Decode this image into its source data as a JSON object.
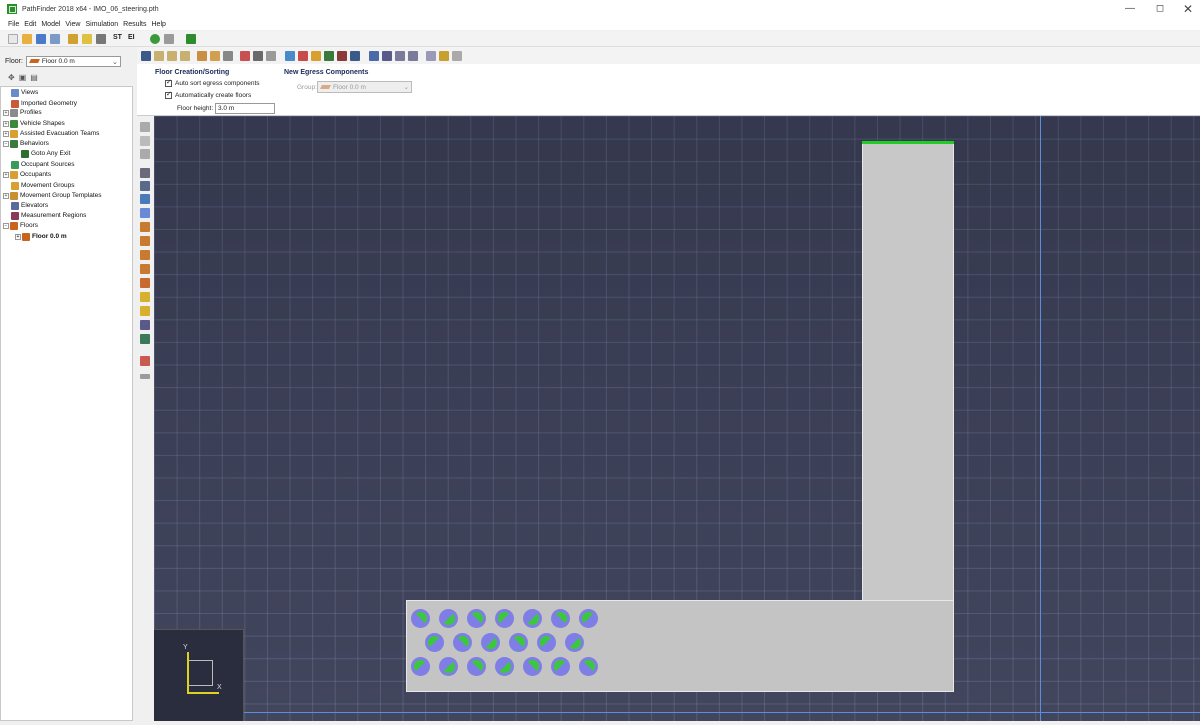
{
  "window": {
    "title": "PathFinder 2018 x64 - IMO_06_steering.pth",
    "minimize_glyph": "—",
    "maximize_glyph": "◻",
    "close_glyph": "✕"
  },
  "menubar": {
    "items": [
      "File",
      "Edit",
      "Model",
      "View",
      "Simulation",
      "Results",
      "Help"
    ]
  },
  "toolbar": {
    "st_label": "ST",
    "sfpe_label": "EI"
  },
  "floor_selector": {
    "label": "Floor:",
    "value": "Floor 0.0 m"
  },
  "tree": {
    "items": [
      {
        "label": "Views",
        "icon": "views-icon"
      },
      {
        "label": "Imported Geometry",
        "icon": "geometry-icon"
      },
      {
        "label": "Profiles",
        "icon": "profiles-icon"
      },
      {
        "label": "Vehicle Shapes",
        "icon": "vehicle-icon"
      },
      {
        "label": "Assisted Evacuation Teams",
        "icon": "teams-icon"
      },
      {
        "label": "Behaviors",
        "icon": "behaviors-icon"
      },
      {
        "label": "Goto Any Exit",
        "icon": "goto-exit-icon"
      },
      {
        "label": "Occupant Sources",
        "icon": "sources-icon"
      },
      {
        "label": "Occupants",
        "icon": "occupants-icon"
      },
      {
        "label": "Movement Groups",
        "icon": "groups-icon"
      },
      {
        "label": "Movement Group Templates",
        "icon": "templates-icon"
      },
      {
        "label": "Elevators",
        "icon": "elevators-icon"
      },
      {
        "label": "Measurement Regions",
        "icon": "regions-icon"
      },
      {
        "label": "Floors",
        "icon": "floors-icon"
      },
      {
        "label": "Floor 0.0 m",
        "icon": "floor-icon"
      }
    ]
  },
  "properties": {
    "floor_creation_title": "Floor Creation/Sorting",
    "auto_sort_label": "Auto sort egress components",
    "auto_create_label": "Automatically create floors",
    "floor_height_label": "Floor height:",
    "floor_height_value": "3.0 m",
    "new_egress_title": "New Egress Components",
    "group_label": "Group:",
    "group_value": "Floor 0.0 m"
  },
  "viewport": {
    "axis_x": "X",
    "axis_y": "Y",
    "background_color": "#3c4058",
    "room_color": "#c4c4c4",
    "exit_color": "#22cc22",
    "occupant_color": "#7e7ee6",
    "occupant_direction_color": "#3cc83c"
  }
}
